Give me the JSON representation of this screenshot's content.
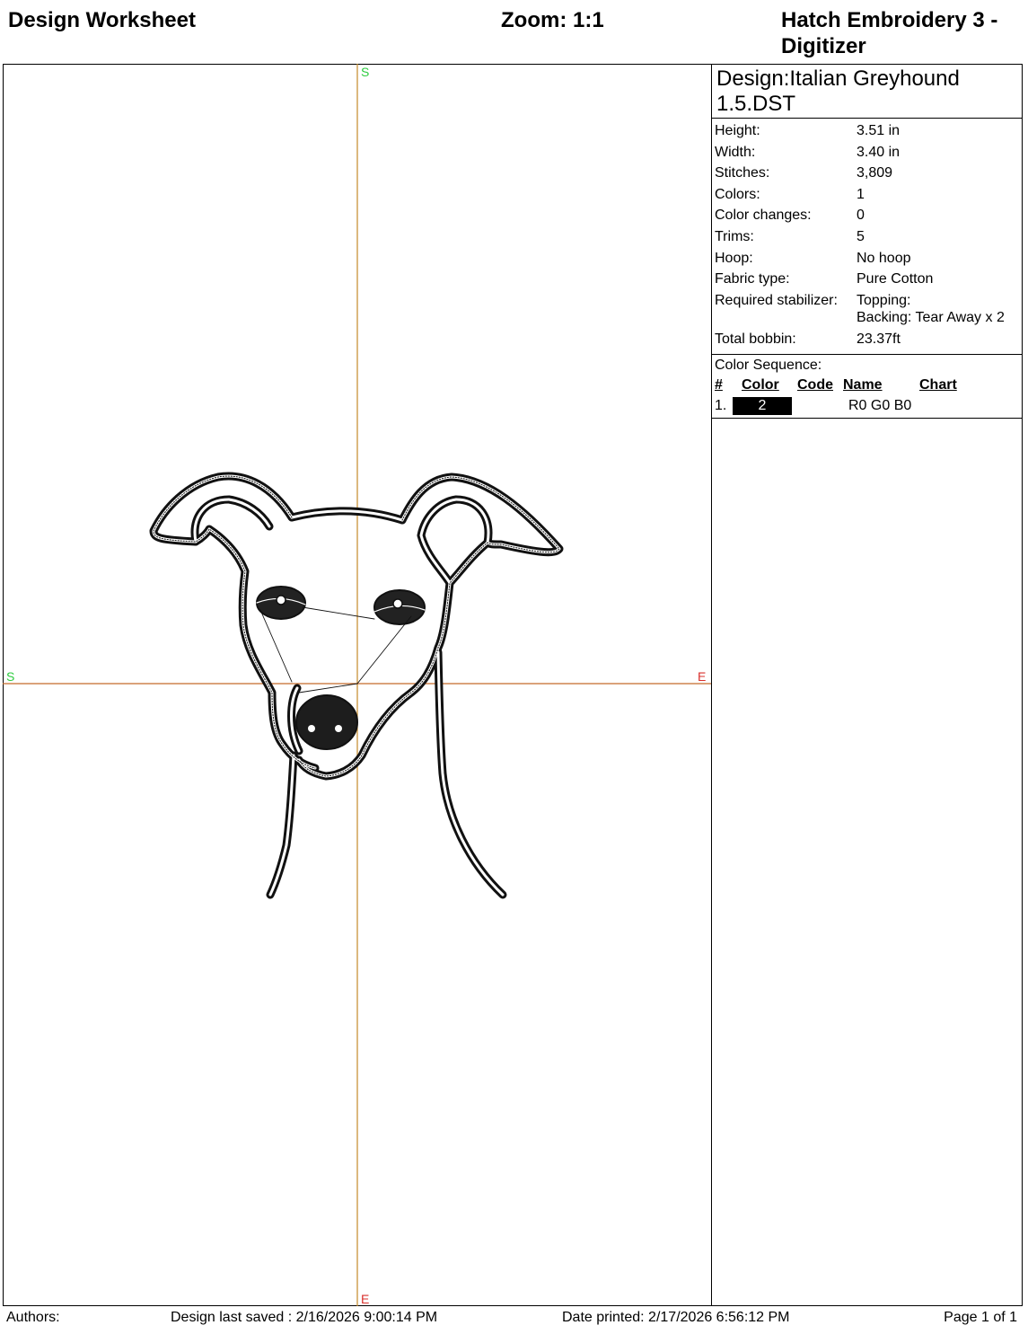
{
  "header": {
    "title": "Design Worksheet",
    "zoom": "Zoom:  1:1",
    "app": "Hatch Embroidery 3 - Digitizer"
  },
  "canvas": {
    "axis_start_label": "S",
    "axis_end_label": "E",
    "colors": {
      "vertical_axis": "#c48a2a",
      "horizontal_axis": "#c46a2a",
      "start": "#2ecc40",
      "end": "#d9302c",
      "stitch": "#1a1a1a"
    },
    "design_image": "italian-greyhound-outline"
  },
  "panel": {
    "design_name": "Design:Italian Greyhound 1.5.DST",
    "info": [
      {
        "label": "Height:",
        "value": "3.51 in"
      },
      {
        "label": "Width:",
        "value": "3.40 in"
      },
      {
        "label": "Stitches:",
        "value": "3,809"
      },
      {
        "label": "Colors:",
        "value": "1"
      },
      {
        "label": "Color changes:",
        "value": "0"
      },
      {
        "label": "Trims:",
        "value": "5"
      },
      {
        "label": "Hoop:",
        "value": "No hoop"
      },
      {
        "label": "Fabric type:",
        "value": "Pure Cotton"
      },
      {
        "label": "Required stabilizer:",
        "value": "Topping:\nBacking: Tear Away x 2"
      },
      {
        "label": "Total bobbin:",
        "value": "23.37ft"
      }
    ],
    "color_sequence": {
      "title": "Color Sequence:",
      "headers": {
        "num": "#",
        "color": "Color",
        "code": "Code",
        "name": "Name",
        "chart": "Chart"
      },
      "rows": [
        {
          "num": "1.",
          "color": "2",
          "code": "",
          "name": "R0 G0 B0",
          "chart": "",
          "swatch": "#000000"
        }
      ]
    }
  },
  "footer": {
    "authors": "Authors:",
    "saved": "Design last saved : 2/16/2026 9:00:14 PM",
    "printed": "Date printed: 2/17/2026 6:56:12 PM",
    "page": "Page 1 of 1"
  }
}
